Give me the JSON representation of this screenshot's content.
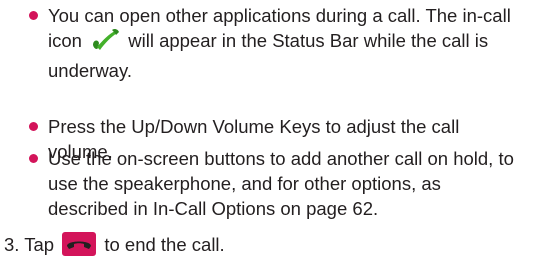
{
  "bullets": [
    {
      "text_before_icon": "You can open other applications during a call. The in-call icon",
      "icon": "in-call-phone-icon",
      "text_after_icon": "will appear in the Status Bar while the call is underway."
    },
    {
      "text": "Press the Up/Down Volume Keys to adjust the call volume."
    },
    {
      "text": "Use the on-screen buttons to add another call on hold, to use the speakerphone, and for other options, as described in In-Call Options on page 62."
    }
  ],
  "step": {
    "text_before_icon": "3. Tap",
    "icon": "end-call-icon",
    "text_after_icon": "to end the call."
  },
  "colors": {
    "bullet": "#d3145a",
    "in_call_icon": "#43b02a",
    "end_call_icon": "#d3145a",
    "text": "#231f20"
  }
}
